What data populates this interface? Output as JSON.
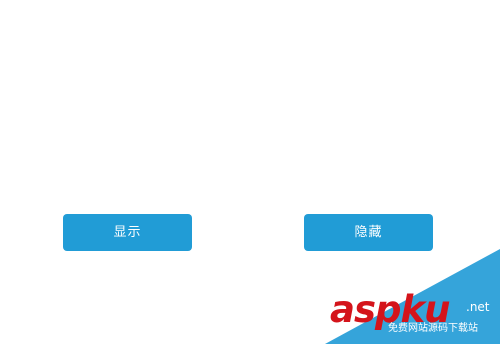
{
  "buttons": {
    "show_label": "显示",
    "hide_label": "隐藏"
  },
  "colors": {
    "button_bg": "#219cd6",
    "button_text": "#ffffff",
    "watermark_red": "#d4141b",
    "watermark_blue": "#2a9fd8"
  },
  "watermark": {
    "logo_text": "aspku",
    "net_text": ".net",
    "subtitle": "免费网站源码下载站"
  }
}
